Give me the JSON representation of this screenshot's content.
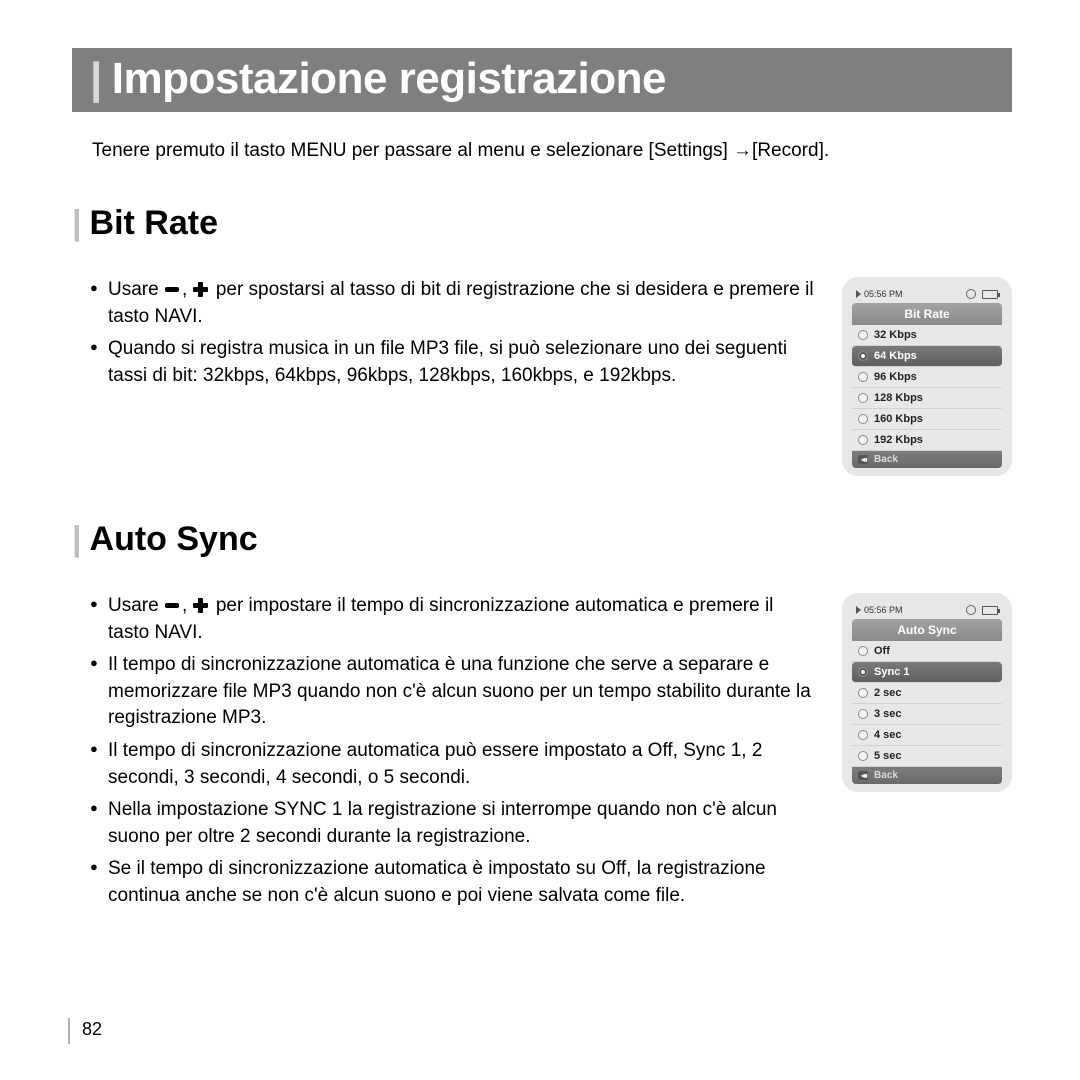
{
  "title": "Impostazione registrazione",
  "intro": "Tenere premuto il tasto MENU per passare al menu e selezionare [Settings] →[Record].",
  "sections": {
    "bitrate": {
      "heading": "Bit Rate",
      "bullets": [
        {
          "pre": "Usare ",
          "post": " per spostarsi al tasso di bit di registrazione che si desidera e premere il tasto NAVI.",
          "icons": true
        },
        {
          "text": "Quando si registra musica in un file MP3 file, si può selezionare uno dei seguenti tassi di bit: 32kbps, 64kbps, 96kbps, 128kbps, 160kbps, e 192kbps."
        }
      ],
      "device": {
        "time": "05:56 PM",
        "header": "Bit Rate",
        "rows": [
          {
            "label": "32 Kbps",
            "selected": false
          },
          {
            "label": "64 Kbps",
            "selected": true
          },
          {
            "label": "96 Kbps",
            "selected": false
          },
          {
            "label": "128 Kbps",
            "selected": false
          },
          {
            "label": "160 Kbps",
            "selected": false
          },
          {
            "label": "192 Kbps",
            "selected": false
          }
        ],
        "back": "Back"
      }
    },
    "autosync": {
      "heading": "Auto Sync",
      "bullets": [
        {
          "pre": "Usare ",
          "post": " per impostare il tempo di sincronizzazione automatica e premere il tasto NAVI.",
          "icons": true
        },
        {
          "text": "Il tempo di sincronizzazione automatica è una funzione che serve a separare e memorizzare file MP3 quando non c'è alcun suono per un tempo stabilito durante la registrazione MP3."
        },
        {
          "text": "Il tempo di sincronizzazione automatica può essere impostato a Off, Sync 1, 2 secondi, 3 secondi, 4 secondi, o 5 secondi."
        },
        {
          "text": "Nella impostazione SYNC 1 la registrazione si interrompe quando non c'è alcun suono per oltre 2 secondi durante la registrazione."
        },
        {
          "text": "Se il tempo di sincronizzazione automatica è impostato su Off, la registrazione continua anche se non c'è alcun suono e poi viene salvata come file."
        }
      ],
      "device": {
        "time": "05:56 PM",
        "header": "Auto Sync",
        "rows": [
          {
            "label": "Off",
            "selected": false
          },
          {
            "label": "Sync 1",
            "selected": true
          },
          {
            "label": "2 sec",
            "selected": false
          },
          {
            "label": "3 sec",
            "selected": false
          },
          {
            "label": "4 sec",
            "selected": false
          },
          {
            "label": "5 sec",
            "selected": false
          }
        ],
        "back": "Back"
      }
    }
  },
  "page": "82"
}
